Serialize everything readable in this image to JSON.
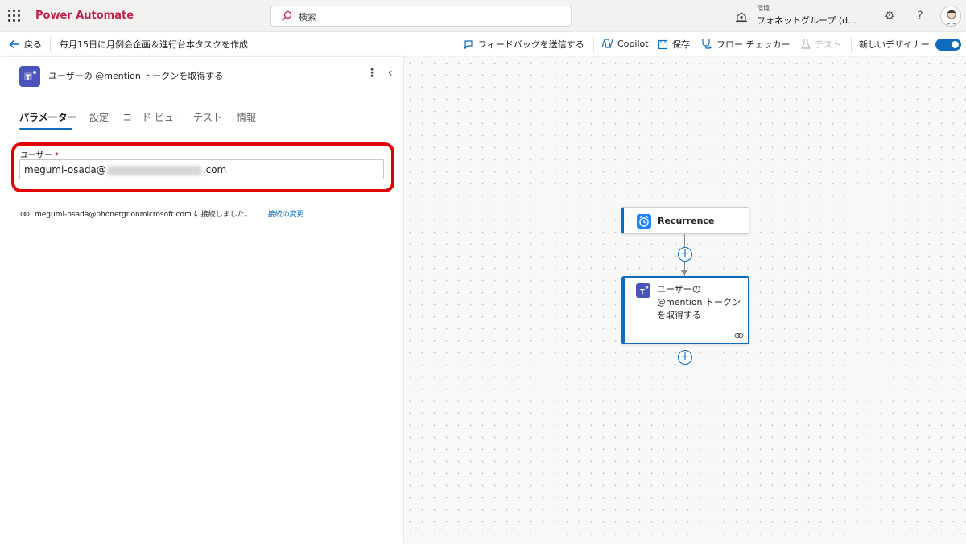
{
  "app": {
    "brand": "Power Automate",
    "search_placeholder": "検索",
    "environment_label": "環境",
    "environment_value": "フォネットグループ (d...",
    "brand_color": "#c3224b",
    "accent_color": "#0f6cbd"
  },
  "commandbar": {
    "back_label": "戻る",
    "flow_name": "毎月15日に月例会企画＆進行台本タスクを作成",
    "feedback_label": "フィードバックを送信する",
    "copilot_label": "Copilot",
    "save_label": "保存",
    "checker_label": "フロー チェッカー",
    "test_label": "テスト",
    "new_designer_label": "新しいデザイナー",
    "new_designer_on": true
  },
  "panel": {
    "title": "ユーザーの @mention トークンを取得する",
    "tabs": [
      {
        "label": "パラメーター",
        "active": true
      },
      {
        "label": "設定",
        "active": false
      },
      {
        "label": "コード ビュー",
        "active": false
      },
      {
        "label": "テスト",
        "active": false
      },
      {
        "label": "情報",
        "active": false
      }
    ],
    "field": {
      "label": "ユーザー",
      "required_mark": "*",
      "value_prefix": "megumi-osada@",
      "value_suffix": ".com"
    },
    "connection": {
      "text": "megumi-osada@phonetgr.onmicrosoft.com に接続しました。",
      "change_link": "接続の変更"
    }
  },
  "canvas": {
    "trigger_node": {
      "label": "Recurrence",
      "icon": "alarm-clock-icon"
    },
    "action_node": {
      "label": "ユーザーの @mention トークンを取得する",
      "icon": "teams-icon"
    }
  }
}
